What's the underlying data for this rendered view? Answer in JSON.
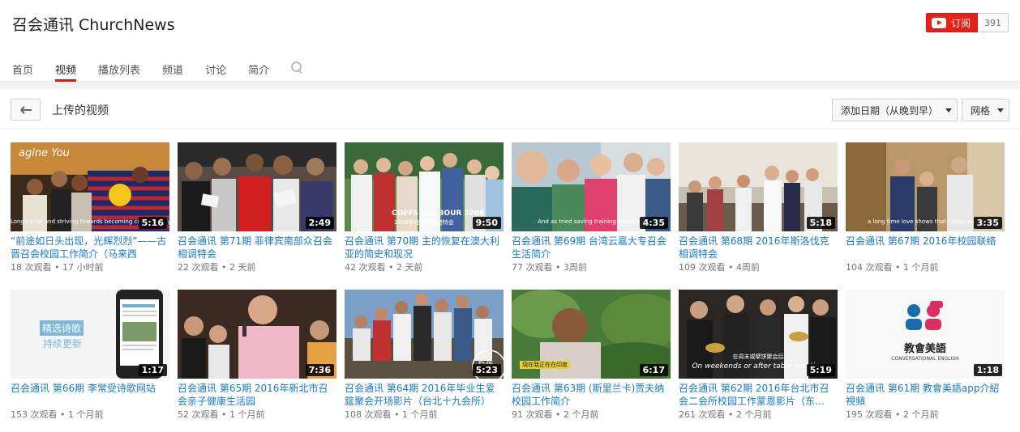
{
  "channel": {
    "title": "召会通讯 ChurchNews",
    "subscribe_label": "订阅",
    "subscriber_count": "391"
  },
  "tabs": [
    {
      "label": "首页"
    },
    {
      "label": "视频"
    },
    {
      "label": "播放列表"
    },
    {
      "label": "频道"
    },
    {
      "label": "讨论"
    },
    {
      "label": "简介"
    }
  ],
  "toolbar": {
    "section_title": "上传的视频",
    "sort_label": "添加日期（从晚到早）",
    "view_label": "网格"
  },
  "colors": {
    "accent": "#cc181e",
    "link": "#167ac6",
    "meta": "#767676"
  },
  "videos": [
    {
      "title": "“前途如日头出现，光辉烈烈”——古晋召会校园工作简介（马来西",
      "views": "18 次观看",
      "age": "17 小时前",
      "duration": "5:16"
    },
    {
      "title": "召会通讯 第71期 菲律宾南部众召会相调特会",
      "views": "22 次观看",
      "age": "2 天前",
      "duration": "2:49"
    },
    {
      "title": "召会通讯 第70期 主的恢复在澳大利亚的简史和现况",
      "views": "42 次观看",
      "age": "2 天前",
      "duration": "9:50"
    },
    {
      "title": "召会通讯 第69期 台湾云嘉大专召会生活简介",
      "views": "77 次观看",
      "age": "3周前",
      "duration": "4:35"
    },
    {
      "title": "召会通讯 第68期 2016年斯洛伐克相调特会",
      "views": "109 次观看",
      "age": "4周前",
      "duration": "5:18"
    },
    {
      "title": "召会通讯 第67期 2016年校园联络",
      "views": "104 次观看",
      "age": "1 个月前",
      "duration": "3:35"
    },
    {
      "title": "召会通讯 第66期 李常受诗歌网站",
      "views": "153 次观看",
      "age": "1 个月前",
      "duration": "1:17"
    },
    {
      "title": "召会通讯 第65期 2016年新北市召会亲子健康生活园",
      "views": "52 次观看",
      "age": "1 个月前",
      "duration": "7:36"
    },
    {
      "title": "召会通讯 第64期 2016年毕业生爱筵聚会开场影片（台北十九会所）",
      "views": "108 次观看",
      "age": "1 个月前",
      "duration": "5:23"
    },
    {
      "title": "召会通讯 第63期 (斯里兰卡)贾夫纳校园工作简介",
      "views": "91 次观看",
      "age": "2 个月前",
      "duration": "6:17"
    },
    {
      "title": "召会通讯 第62期 2016年台北市召会二会所校园工作蒙恩影片（东…",
      "views": "261 次观看",
      "age": "2 个月前",
      "duration": "5:19"
    },
    {
      "title": "召会通讯 第61期 教會美語app介紹視頻",
      "views": "195 次观看",
      "age": "2 个月前",
      "duration": "1:18"
    }
  ],
  "thumb_text": {
    "v1_banner": "agine You",
    "v1_caption": "Longing for and striving towards becoming completely your",
    "v3_caption_top": "COFFS HARBOUR 2006",
    "v3_caption": "2006年在科夫斯港特会",
    "v4_caption": "And as tried saving training meetings",
    "v6_caption": "a long time love shows that I have loved",
    "v7_badge_top": "精选诗歌",
    "v7_badge_bottom": "持续更新",
    "v9_badge": "戶外",
    "v10_caption": "現在我正在在印度",
    "v11_caption_cn": "在周末或擘饼聚会后",
    "v11_caption_en": "On weekends or after table meeting",
    "v12_logo_cn": "教會美語",
    "v12_logo_en": "CONVERSATIONAL ENGLISH"
  }
}
